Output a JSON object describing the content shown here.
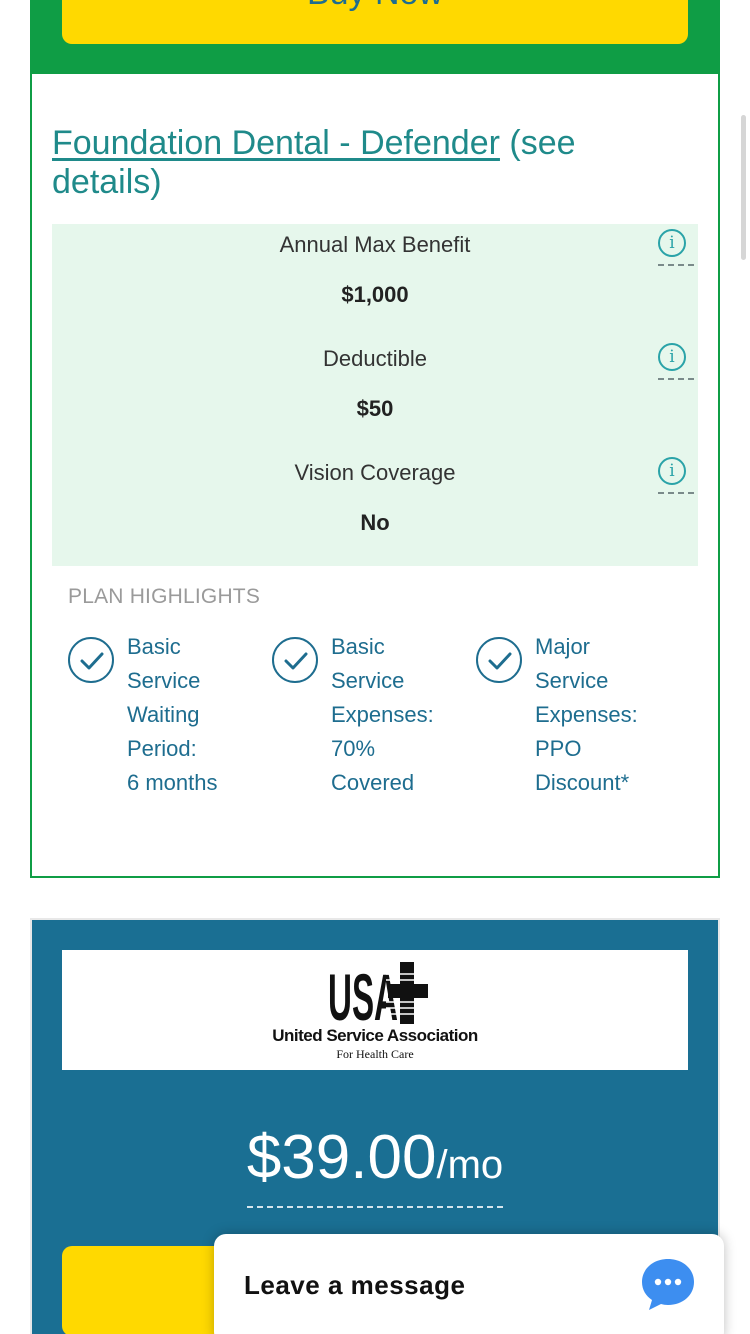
{
  "top_card": {
    "buy_label": "Buy Now",
    "plan_link": "Foundation Dental - Defender",
    "plan_details": " (see details)",
    "benefits": [
      {
        "label": "Annual Max Benefit",
        "value": "$1,000"
      },
      {
        "label": "Deductible",
        "value": "$50"
      },
      {
        "label": "Vision Coverage",
        "value": "No"
      }
    ],
    "highlights_title": "PLAN HIGHLIGHTS",
    "highlights": [
      {
        "lines": [
          "Basic",
          "Service",
          "Waiting",
          "Period:",
          "6 months"
        ]
      },
      {
        "lines": [
          "Basic",
          "Service",
          "Expenses:",
          "70%",
          "Covered"
        ]
      },
      {
        "lines": [
          "Major",
          "Service",
          "Expenses:",
          "PPO",
          "Discount*"
        ]
      }
    ]
  },
  "second_card": {
    "logo_text": "USA",
    "logo_name": "United Service Association",
    "logo_sub": "For Health Care",
    "price": "$39.00",
    "price_unit": "/mo"
  },
  "chat": {
    "label": "Leave a message",
    "icon": "chat-bubble-icon"
  },
  "colors": {
    "green": "#0f9d45",
    "yellow": "#ffd900",
    "blue": "#1a6f93",
    "teal": "#1f8a8a",
    "mint": "#e6f7ec"
  }
}
